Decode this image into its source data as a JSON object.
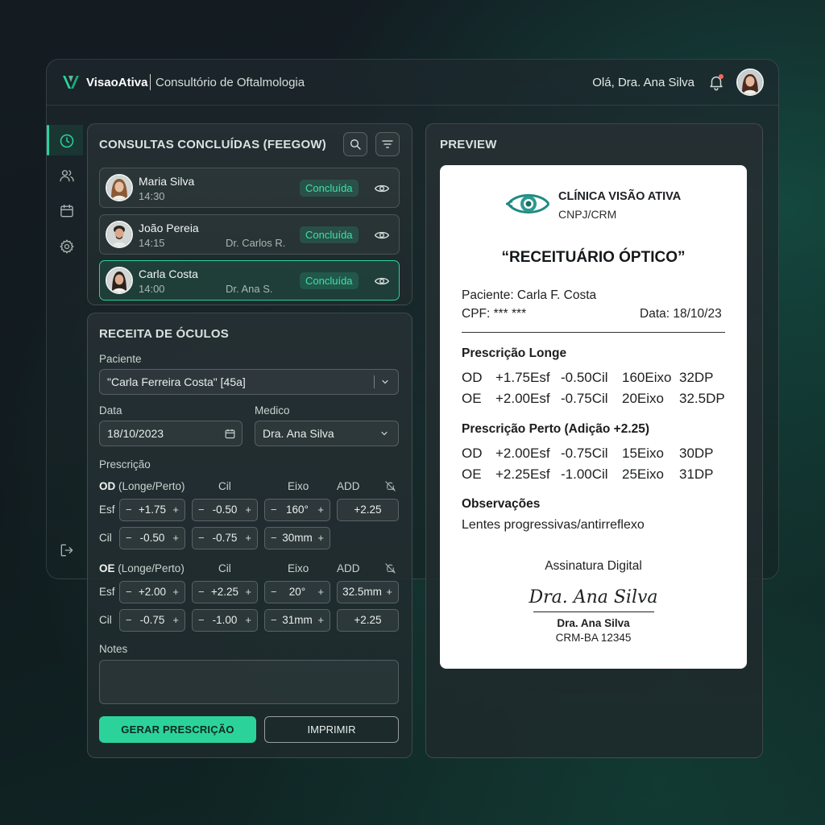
{
  "header": {
    "brand": "VisaoAtiva",
    "subtitle": "Consultório de Oftalmologia",
    "greeting": "Olá, Dra. Ana Silva"
  },
  "sidebar": {
    "items": [
      {
        "icon": "clock-icon",
        "active": true
      },
      {
        "icon": "users-icon",
        "active": false
      },
      {
        "icon": "calendar-icon",
        "active": false
      },
      {
        "icon": "gear-icon",
        "active": false
      }
    ],
    "footer_icon": "logout-icon"
  },
  "consultations": {
    "title": "CONSULTAS CONCLUÍDAS (FEEGOW)",
    "items": [
      {
        "name": "Maria Silva",
        "time": "14:30",
        "doctor": "",
        "status": "Concluída"
      },
      {
        "name": "João Pereia",
        "time": "14:15",
        "doctor": "Dr. Carlos R.",
        "status": "Concluída"
      },
      {
        "name": "Carla Costa",
        "time": "14:00",
        "doctor": "Dr. Ana S.",
        "status": "Concluída",
        "selected": true
      }
    ]
  },
  "form": {
    "title": "RECEITA DE ÓCULOS",
    "patient_label": "Paciente",
    "patient_value": "\"Carla Ferreira Costa\" [45a]",
    "date_label": "Data",
    "date_value": "18/10/2023",
    "doctor_label": "Medico",
    "doctor_value": "Dra. Ana Silva",
    "prescription_label": "Prescrição",
    "od": {
      "title_bold": "OD",
      "title_rest": " (Longe/Perto)",
      "col_cil": "Cil",
      "col_eixo": "Eixo",
      "col_add": "ADD",
      "row1_label": "Esf",
      "row1": [
        "+1.75",
        "-0.50",
        "160°",
        "+2.25"
      ],
      "row2_label": "Cil",
      "row2": [
        "-0.50",
        "-0.75",
        "30mm"
      ]
    },
    "oe": {
      "title_bold": "OE",
      "title_rest": " (Longe/Perto)",
      "col_cil": "Cil",
      "col_eixo": "Eixo",
      "col_add": "ADD",
      "row1_label": "Esf",
      "row1": [
        "+2.00",
        "+2.25",
        "20°",
        "32.5mm"
      ],
      "row2_label": "Cil",
      "row2": [
        "-0.75",
        "-1.00",
        "31mm",
        "+2.25"
      ]
    },
    "notes_label": "Notes",
    "notes_value": "",
    "generate_button": "GERAR PRESCRIÇÃO",
    "print_button": "IMPRIMIR"
  },
  "preview": {
    "title": "PREVIEW",
    "clinic_name": "CLÍNICA VISÃO ATIVA",
    "clinic_id": "CNPJ/CRM",
    "doc_title": "“RECEITUÁRIO ÓPTICO”",
    "patient": "Paciente: Carla F. Costa",
    "cpf": "CPF: *** ***",
    "date": "Data: 18/10/23",
    "far_title": "Prescrição Longe",
    "far_rows": [
      [
        "OD",
        "+1.75Esf",
        "-0.50Cil",
        "160Eixo",
        "32DP"
      ],
      [
        "OE",
        "+2.00Esf",
        "-0.75Cil",
        "20Eixo",
        "32.5DP"
      ]
    ],
    "near_title": "Prescrição Perto (Adição +2.25)",
    "near_rows": [
      [
        "OD",
        "+2.00Esf",
        "-0.75Cil",
        "15Eixo",
        "30DP"
      ],
      [
        "OE",
        "+2.25Esf",
        "-1.00Cil",
        "25Eixo",
        "31DP"
      ]
    ],
    "obs_title": "Observações",
    "obs_text": "Lentes progressivas/antirreflexo",
    "signature_label": "Assinatura Digital",
    "signature_script": "Dra. Ana Silva",
    "doctor_name": "Dra. Ana Silva",
    "doctor_crm": "CRM-BA 12345"
  },
  "colors": {
    "accent": "#2bd39b",
    "notification": "#f26a5b",
    "badge_text": "#3ee0a7"
  }
}
